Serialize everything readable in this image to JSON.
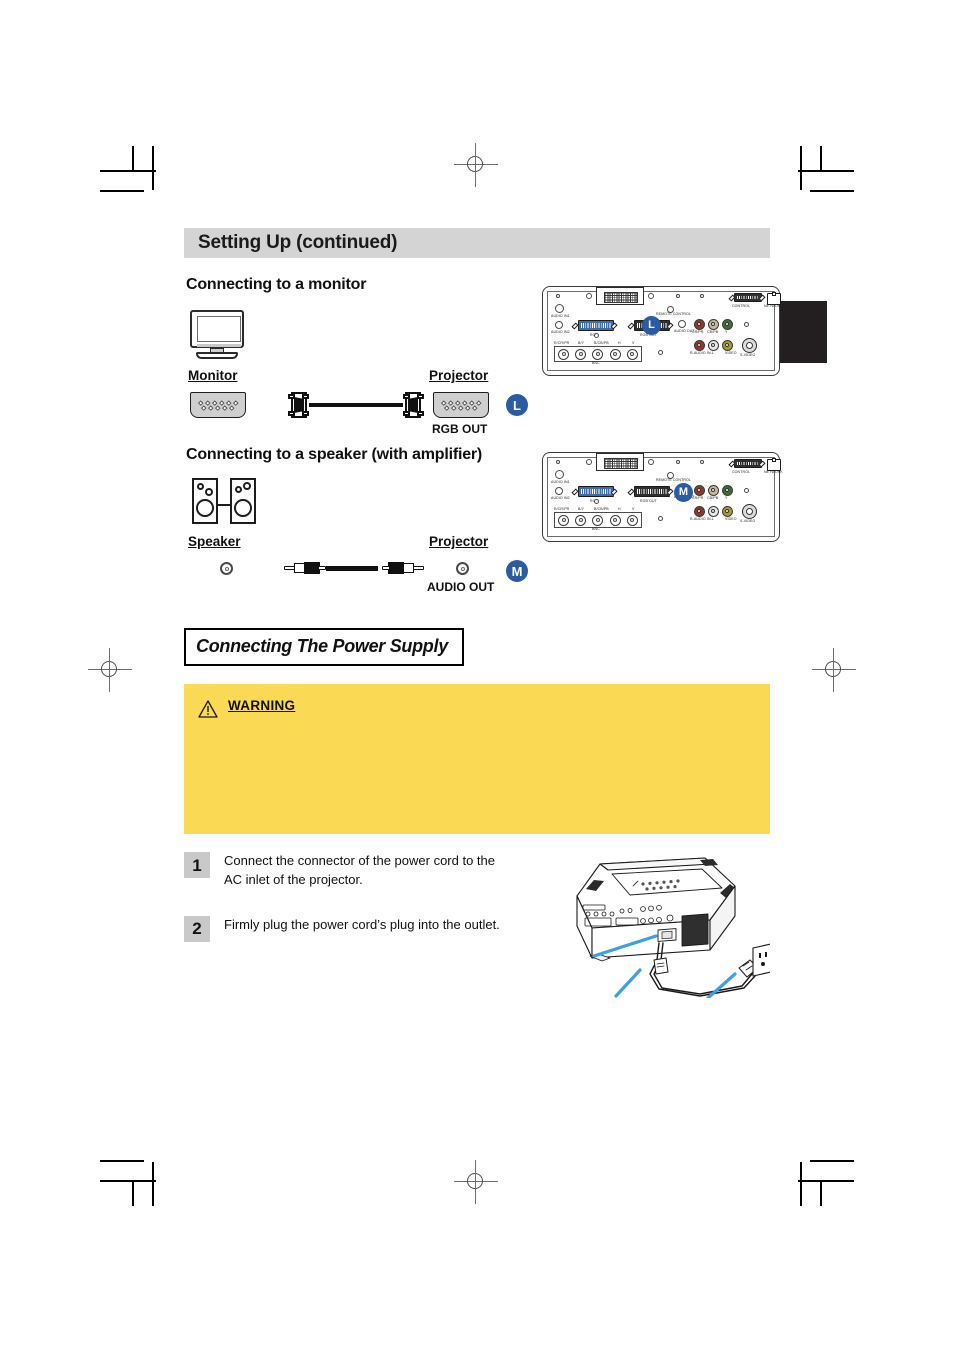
{
  "page": {
    "title": "Setting Up (continued)"
  },
  "sections": {
    "monitor": {
      "heading": "Connecting to a monitor",
      "source_label": "Monitor",
      "target_label": "Projector",
      "target_port_label": "RGB OUT",
      "badge": "L",
      "source_icon": "crt-monitor-icon",
      "cable_icon": "vga-cable-icon"
    },
    "speaker": {
      "heading": "Connecting to a speaker (with amplifier)",
      "source_label": "Speaker",
      "target_label": "Projector",
      "target_port_label": "AUDIO OUT",
      "badge": "M",
      "source_icon": "speaker-pair-icon",
      "cable_icon": "rca-audio-cable-icon"
    }
  },
  "panel": {
    "labels": {
      "audio_in1": "AUDIO IN1",
      "audio_in2": "AUDIO IN2",
      "rgb": "RGB",
      "rgb_out": "RGB OUT",
      "audio_out": "AUDIO OUT",
      "remote_control": "REMOTE CONTROL",
      "control": "CONTROL",
      "network": "NETWORK",
      "cr_pr": "CR/PR",
      "cb_pb": "CB/PB",
      "y": "Y",
      "audio_in_rl": "R-AUDIO IN-L",
      "video": "VIDEO",
      "s_video": "S-VIDEO",
      "bnc": "BNC"
    },
    "bnc_pins": [
      "R/CR/PR",
      "B/Y",
      "B/CB/PB",
      "H",
      "V"
    ]
  },
  "power_supply": {
    "heading": "Connecting The Power Supply",
    "warning": {
      "title": "WARNING",
      "icon": "warning-triangle-icon",
      "body": ""
    },
    "steps": [
      {
        "number": "1",
        "text": "Connect the connector of the power cord to the AC inlet of the projector."
      },
      {
        "number": "2",
        "text": "Firmly plug the power cord’s plug into the outlet."
      }
    ],
    "illustration": "projector-power-cord-outlet-illustration"
  },
  "colors": {
    "title_bar": "#d4d4d4",
    "warning_bg": "#fada55",
    "badge_blue": "#2b5ba1",
    "step_num_bg": "#c9c9c9"
  }
}
